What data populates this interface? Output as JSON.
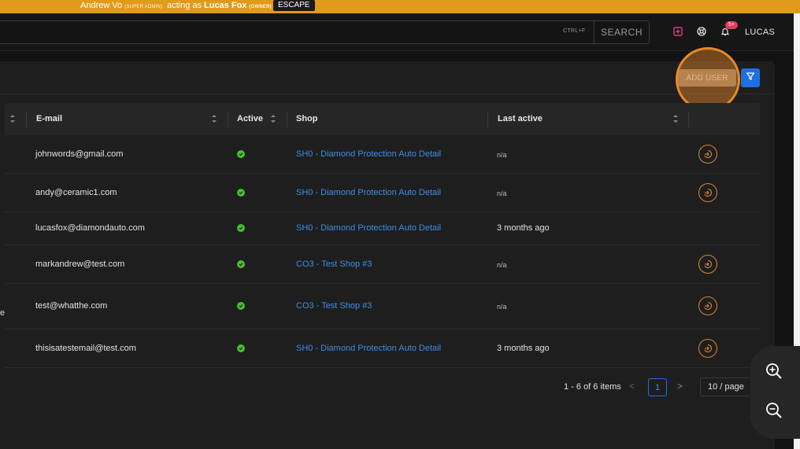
{
  "banner": {
    "admin_name": "Andrew Vo",
    "admin_role": "(SUPER ADMIN)",
    "acting_text": "acting as",
    "target_name": "Lucas Fox",
    "target_role": "(OWNER)",
    "escape_label": "ESCAPE",
    "color": "#e09b1a"
  },
  "topbar": {
    "search_placeholder": "",
    "shortcut": "CTRL+F",
    "search_label": "SEARCH",
    "notification_badge": "5+",
    "user_label": "LUCAS",
    "icons": [
      "add-square-icon",
      "support-icon",
      "bell-icon"
    ]
  },
  "card": {
    "add_user_label": "ADD USER",
    "filter_icon": "filter-icon",
    "accent": "#1e6fe0"
  },
  "table": {
    "columns": {
      "email": "E-mail",
      "active": "Active",
      "shop": "Shop",
      "last_active": "Last active"
    },
    "rows": [
      {
        "email": "johnwords@gmail.com",
        "shop": "SH0 - Diamond Protection Auto Detail",
        "last_active": "n/a",
        "active": true
      },
      {
        "email": "andy@ceramic1.com",
        "shop": "SH0 - Diamond Protection Auto Detail",
        "last_active": "n/a",
        "active": true
      },
      {
        "email": "lucasfox@diamondauto.com",
        "shop": "SH0 - Diamond Protection Auto Detail",
        "last_active": "3 months ago",
        "active": true
      },
      {
        "email": "markandrew@test.com",
        "shop": "CO3 - Test Shop #3",
        "last_active": "n/a",
        "active": true
      },
      {
        "email": "test@whatthe.com",
        "shop": "CO3 - Test Shop #3",
        "last_active": "n/a",
        "active": true,
        "edge": "e"
      },
      {
        "email": "thisisatestemail@test.com",
        "shop": "SH0 - Diamond Protection Auto Detail",
        "last_active": "3 months ago",
        "active": true
      }
    ]
  },
  "pagination": {
    "range": "1 - 6 of 6 items",
    "prev": "<",
    "current_page": "1",
    "next": ">",
    "page_size": "10 / page"
  },
  "colors": {
    "active_green": "#45c02f",
    "shop_link": "#3d8fe8",
    "login_orange": "#d88833",
    "highlight": "#e8892a"
  }
}
